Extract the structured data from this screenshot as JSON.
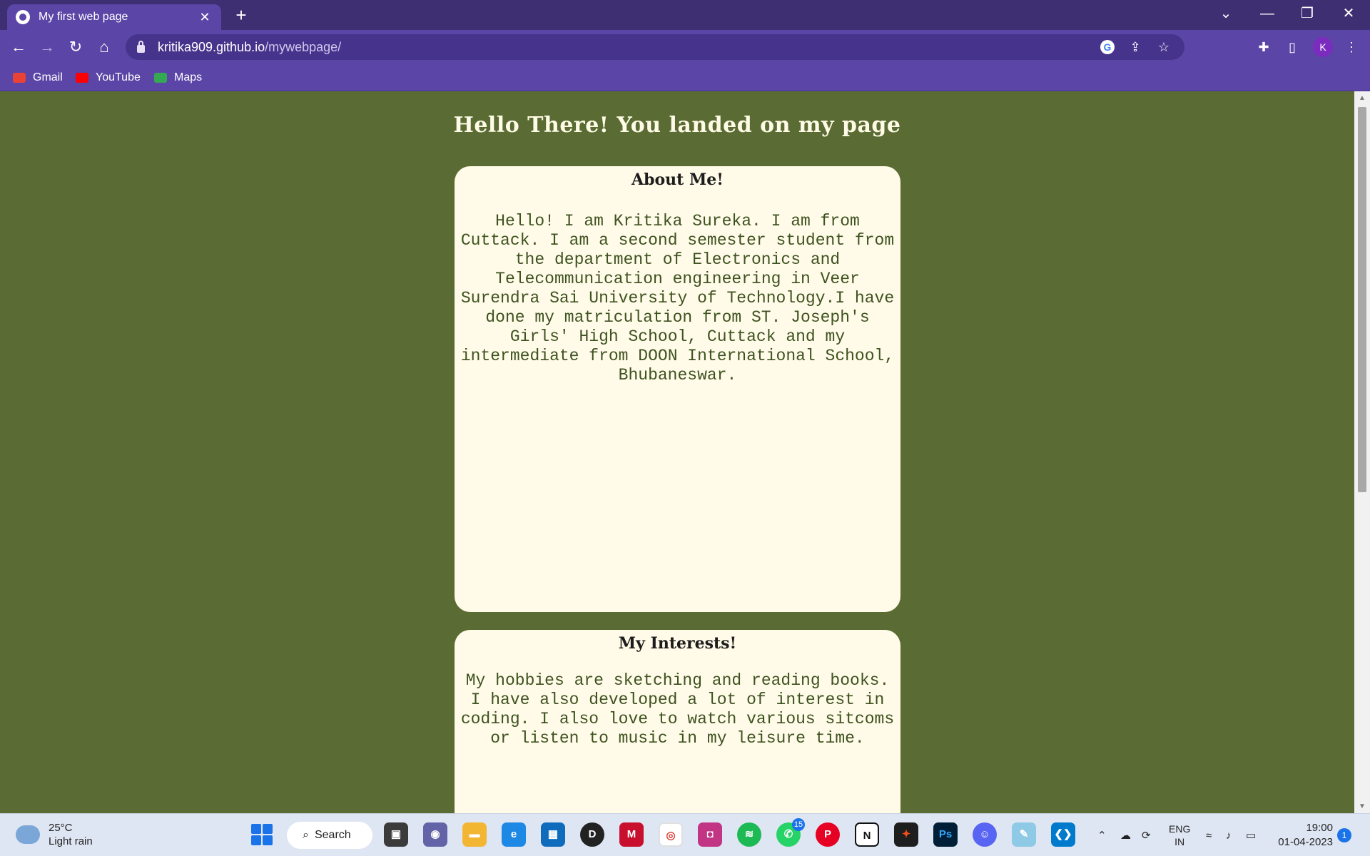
{
  "browser": {
    "tab_title": "My first web page",
    "tab_close": "✕",
    "new_tab": "+",
    "url_host": "kritika909.github.io",
    "url_path": "/mywebpage/",
    "profile_initial": "K",
    "bookmarks": [
      {
        "label": "Gmail",
        "color": "#ea4335"
      },
      {
        "label": "YouTube",
        "color": "#ff0000"
      },
      {
        "label": "Maps",
        "color": "#34a853"
      }
    ]
  },
  "page": {
    "heading": "Hello There! You landed on my page",
    "about": {
      "title": "About Me!",
      "body": "Hello! I am Kritika Sureka. I am from Cuttack. I am a second semester student from the department of Electronics and Telecommunication engineering in Veer Surendra Sai University of Technology.I have done my matriculation from ST. Joseph's Girls' High School, Cuttack and my intermediate from DOON International School, Bhubaneswar."
    },
    "interests": {
      "title": "My Interests!",
      "body": "My hobbies are sketching and reading books. I have also developed a lot of interest in coding. I also love to watch various sitcoms or listen to music in my leisure time."
    }
  },
  "taskbar": {
    "weather_temp": "25°C",
    "weather_desc": "Light rain",
    "search_label": "Search",
    "whatsapp_badge": "15",
    "lang_top": "ENG",
    "lang_bottom": "IN",
    "time": "19:00",
    "date": "01-04-2023",
    "notifications": "1"
  },
  "colors": {
    "page_bg": "#5a6b33",
    "card_bg": "#fffbe8",
    "chrome_purple": "#5b45a6"
  }
}
